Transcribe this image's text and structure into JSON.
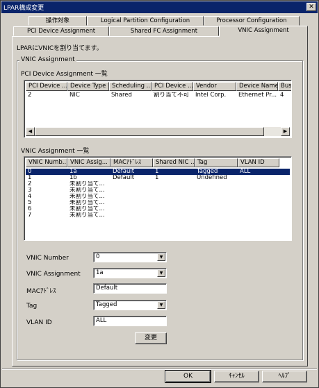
{
  "window": {
    "title": "LPAR構成変更",
    "close_glyph": "✕"
  },
  "tabs": {
    "row1": [
      {
        "label": "操作対象"
      },
      {
        "label": "Logical Partition Configuration"
      },
      {
        "label": "Processor Configuration"
      }
    ],
    "row2": [
      {
        "label": "PCI Device Assignment"
      },
      {
        "label": "Shared FC Assignment"
      },
      {
        "label": "VNIC Assignment",
        "active": true
      }
    ]
  },
  "panel": {
    "intro_text": "LPARにVNICを割り当てます。",
    "group_label": "VNIC Assignment",
    "pci_list": {
      "heading": "PCI Device Assignment 一覧",
      "columns": [
        "PCI Device ...",
        "Device Type",
        "Scheduling ...",
        "PCI Device ...",
        "Vendor",
        "Device Name",
        "Bus N..."
      ],
      "rows": [
        [
          "2",
          "NIC",
          "Shared",
          "割り当て不可",
          "Intel Corp.",
          "Ethernet Pr...",
          "4"
        ]
      ]
    },
    "vnic_list": {
      "heading": "VNIC Assignment 一覧",
      "columns": [
        "VNIC Numb...",
        "VNIC Assig...",
        "MACｱﾄﾞﾚｽ",
        "Shared NIC ...",
        "Tag",
        "VLAN ID"
      ],
      "rows": [
        [
          "0",
          "1a",
          "Default",
          "1",
          "Tagged",
          "ALL"
        ],
        [
          "1",
          "1b",
          "Default",
          "1",
          "Undefined",
          ""
        ],
        [
          "2",
          "未割り当て...",
          "",
          "",
          "",
          ""
        ],
        [
          "3",
          "未割り当て...",
          "",
          "",
          "",
          ""
        ],
        [
          "4",
          "未割り当て...",
          "",
          "",
          "",
          ""
        ],
        [
          "5",
          "未割り当て...",
          "",
          "",
          "",
          ""
        ],
        [
          "6",
          "未割り当て...",
          "",
          "",
          "",
          ""
        ],
        [
          "7",
          "未割り当て...",
          "",
          "",
          "",
          ""
        ]
      ],
      "selected_row": 0
    },
    "form": {
      "vnic_number": {
        "label": "VNIC Number",
        "value": "0"
      },
      "vnic_assignment": {
        "label": "VNIC Assignment",
        "value": "1a"
      },
      "mac_address": {
        "label": "MACｱﾄﾞﾚｽ",
        "value": "Default"
      },
      "tag": {
        "label": "Tag",
        "value": "Tagged"
      },
      "vlan_id": {
        "label": "VLAN ID",
        "value": "ALL"
      },
      "change_button": "変更"
    }
  },
  "footer": {
    "ok": "OK",
    "cancel": "ｷｬﾝｾﾙ",
    "help": "ﾍﾙﾌﾟ"
  },
  "colors": {
    "titlebar": "#0a246a",
    "selection": "#0a246a",
    "face": "#d4d0c8"
  },
  "icons": {
    "dropdown": "triangle-down",
    "scroll_left": "triangle-left",
    "scroll_right": "triangle-right"
  }
}
